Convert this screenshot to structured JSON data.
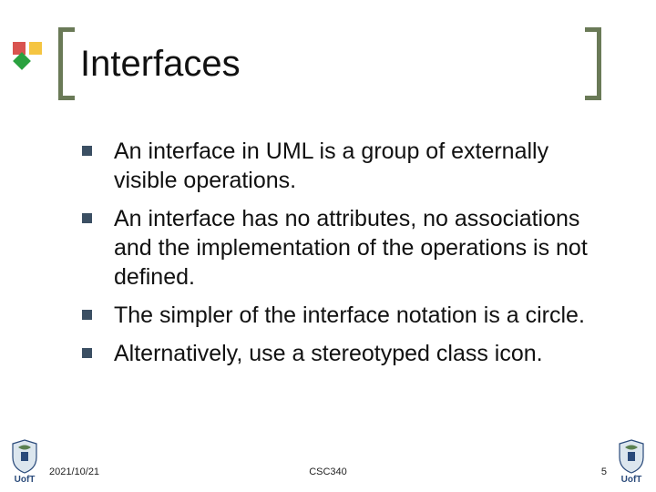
{
  "title": "Interfaces",
  "bullets": [
    "An interface in UML is a group of externally visible operations.",
    "An interface has no attributes, no associations and the implementation of the operations is not defined.",
    "The simpler of the interface notation is a circle.",
    "Alternatively, use a stereotyped class icon."
  ],
  "footer": {
    "date": "2021/10/21",
    "course": "CSC340",
    "page": "5",
    "crest_label": "UofT"
  }
}
